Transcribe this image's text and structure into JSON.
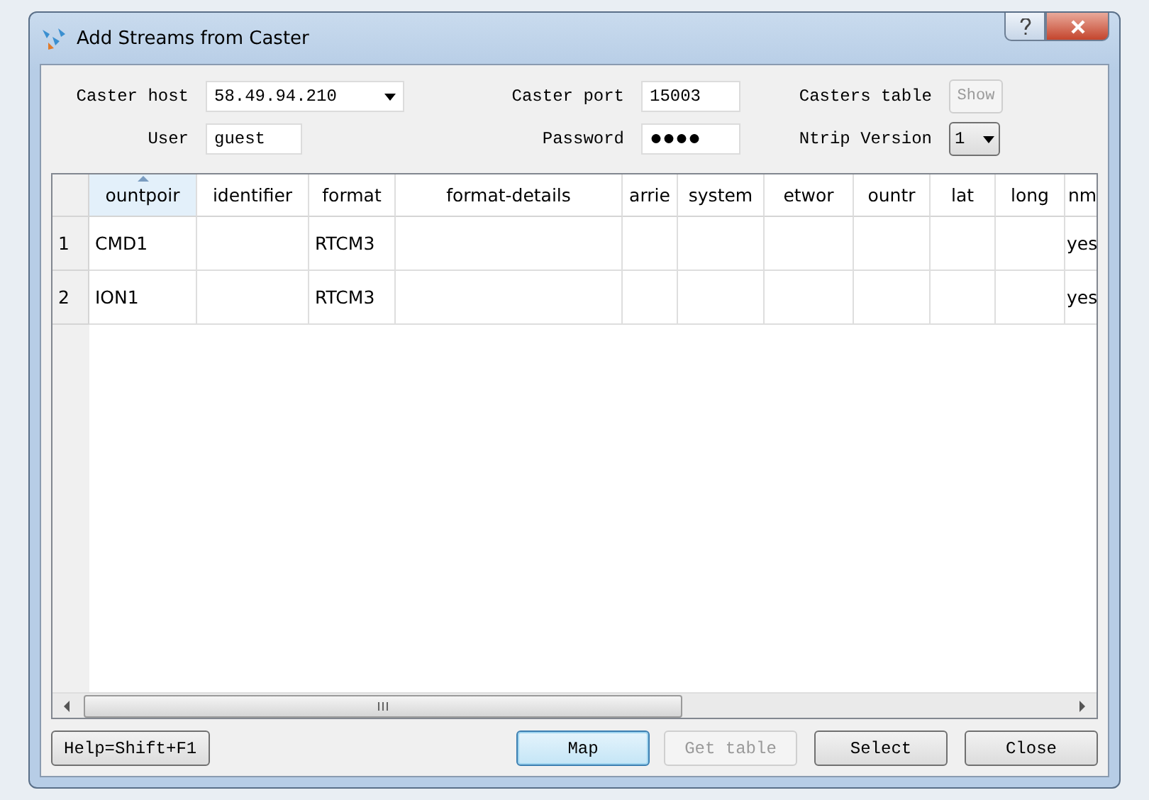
{
  "window": {
    "title": "Add Streams from Caster"
  },
  "form": {
    "caster_host": {
      "label": "Caster host",
      "value": "58.49.94.210"
    },
    "caster_port": {
      "label": "Caster port",
      "value": "15003"
    },
    "casters_table": {
      "label": "Casters table",
      "button": "Show",
      "disabled": true
    },
    "user": {
      "label": "User",
      "value": "guest"
    },
    "password": {
      "label": "Password",
      "value": "●●●●"
    },
    "ntrip_version": {
      "label": "Ntrip Version",
      "value": "1"
    }
  },
  "table": {
    "columns": [
      {
        "label": "ountpoir",
        "sorted": true
      },
      {
        "label": "identifier",
        "sorted": false
      },
      {
        "label": "format",
        "sorted": false
      },
      {
        "label": "format-details",
        "sorted": false
      },
      {
        "label": "arrie",
        "sorted": false
      },
      {
        "label": "system",
        "sorted": false
      },
      {
        "label": "etwor",
        "sorted": false
      },
      {
        "label": "ountr",
        "sorted": false
      },
      {
        "label": "lat",
        "sorted": false
      },
      {
        "label": "long",
        "sorted": false
      },
      {
        "label": "nm",
        "sorted": false
      }
    ],
    "rows": [
      {
        "number": "1",
        "cells": [
          "CMD1",
          "",
          "RTCM3",
          "",
          "",
          "",
          "",
          "",
          "",
          "",
          "yes"
        ]
      },
      {
        "number": "2",
        "cells": [
          "ION1",
          "",
          "RTCM3",
          "",
          "",
          "",
          "",
          "",
          "",
          "",
          "yes"
        ]
      }
    ]
  },
  "buttons": [
    {
      "label": "Help=Shift+F1",
      "default": false,
      "disabled": false
    },
    {
      "label": "Map",
      "default": true,
      "disabled": false
    },
    {
      "label": "Get table",
      "default": false,
      "disabled": true
    },
    {
      "label": "Select",
      "default": false,
      "disabled": false
    },
    {
      "label": "Close",
      "default": false,
      "disabled": false
    }
  ]
}
